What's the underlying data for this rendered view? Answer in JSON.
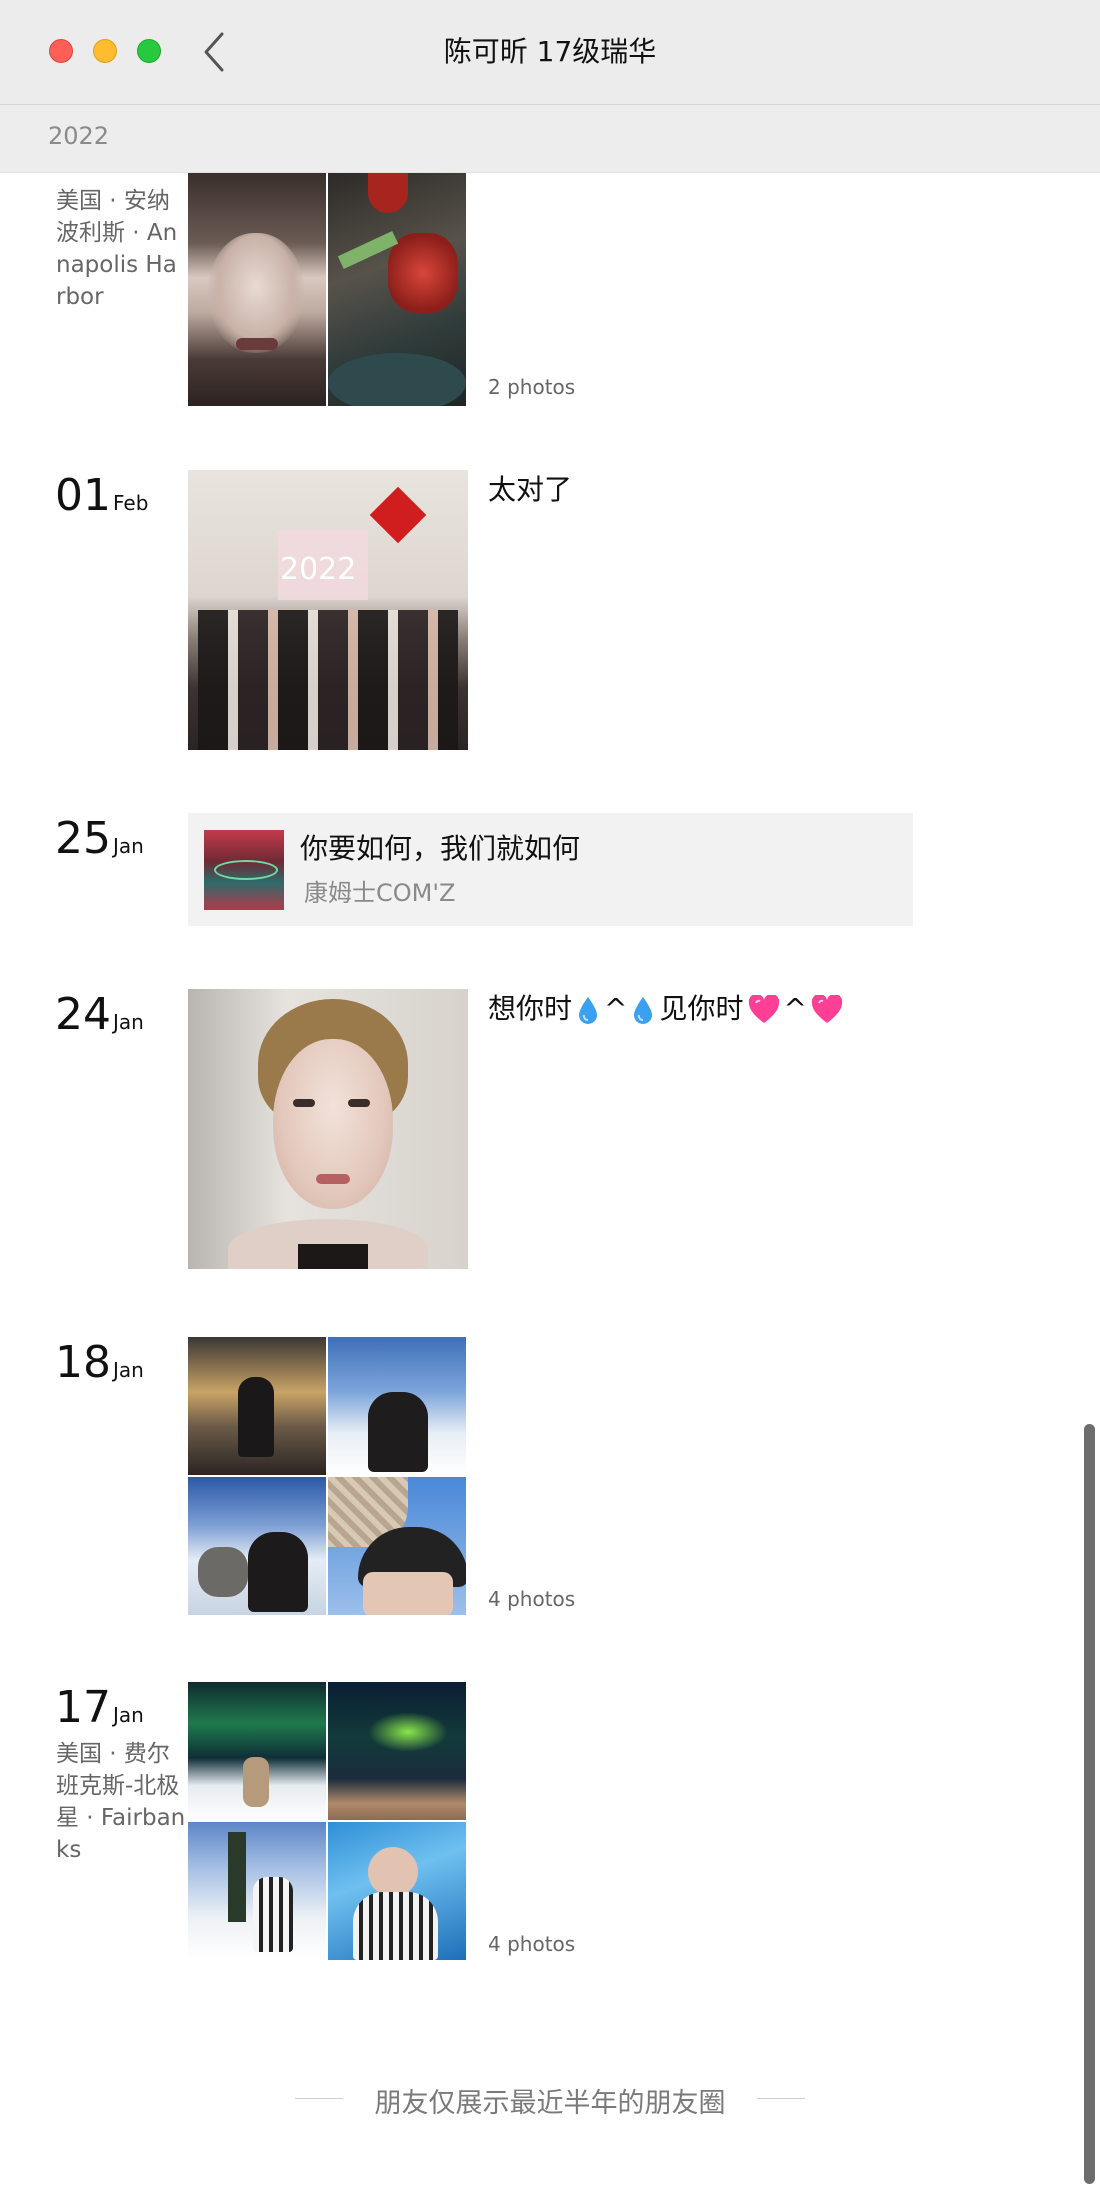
{
  "window": {
    "title": "陈可昕 17级瑞华",
    "back_icon": "chevron-left-icon"
  },
  "year_header": "2022",
  "entries": [
    {
      "location": "美国 · 安纳波利斯 · Annapolis Harbor",
      "photo_count": "2 photos"
    },
    {
      "day": "01",
      "month": "Feb",
      "text": "太对了"
    },
    {
      "day": "25",
      "month": "Jan",
      "music": {
        "title": "你要如何，我们就如何",
        "artist": "康姆士COM'Z"
      }
    },
    {
      "day": "24",
      "month": "Jan",
      "text_part1": "想你时",
      "text_sep1": "^",
      "text_part2": "见你时",
      "text_sep2": "^"
    },
    {
      "day": "18",
      "month": "Jan",
      "photo_count": "4 photos"
    },
    {
      "day": "17",
      "month": "Jan",
      "location": "美国 · 费尔班克斯-北极星 · Fairbanks",
      "photo_count": "4 photos"
    }
  ],
  "footer": "朋友仅展示最近半年的朋友圈",
  "colors": {
    "close": "#fe5f57",
    "minimize": "#febc2e",
    "maximize": "#28c840",
    "titlebar": "#ececec",
    "drop": "#3aa0f0",
    "heart": "#ff3e96"
  }
}
